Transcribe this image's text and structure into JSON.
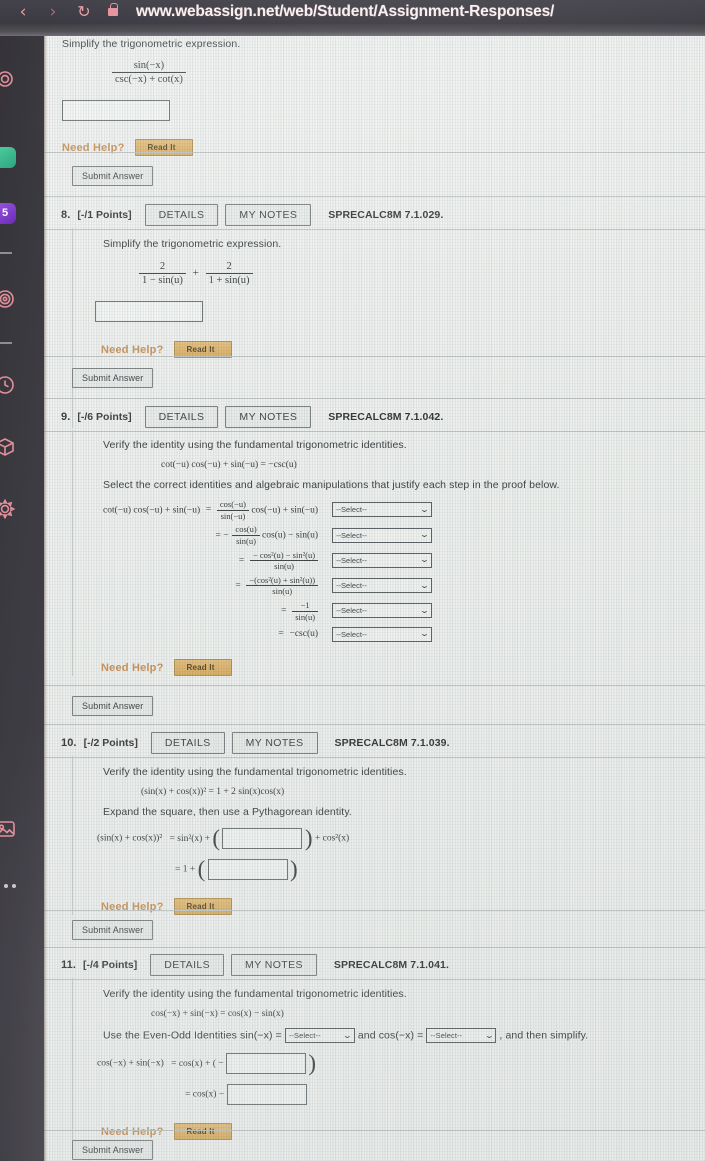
{
  "browser": {
    "url": "www.webassign.net/web/Student/Assignment-Responses/",
    "back_icon": "‹",
    "forward_icon": "›",
    "reload_icon": "↻",
    "lock_icon": "lock-icon"
  },
  "rail": {
    "icons": [
      {
        "name": "app-green-icon",
        "glyph": "",
        "color": "#3ec88a"
      },
      {
        "name": "app-purple-icon",
        "glyph": "5",
        "color": "#8b3ff0"
      },
      {
        "name": "spiral-icon",
        "glyph": "◎",
        "color": "#f08a9a"
      },
      {
        "name": "clock-icon",
        "glyph": "◴",
        "color": "#f08a9a"
      },
      {
        "name": "cube-icon",
        "glyph": "⬡",
        "color": "#f08a9a"
      },
      {
        "name": "gear-icon",
        "glyph": "⚙",
        "color": "#f08a9a"
      },
      {
        "name": "image-icon",
        "glyph": "Ὓc",
        "color": "#f08a9a"
      }
    ],
    "overflow_label": "• • •"
  },
  "common": {
    "details_label": "DETAILS",
    "mynotes_label": "MY NOTES",
    "need_help_label": "Need Help?",
    "read_it_label": "Read It",
    "submit_label": "Submit Answer",
    "select_placeholder": "--Select--",
    "caret": "⌄"
  },
  "questions": [
    {
      "number": "",
      "points": "",
      "code": "",
      "prompt": "Simplify the trigonometric expression.",
      "expression": {
        "numerator": "sin(−x)",
        "denominator": "csc(−x) + cot(x)"
      }
    },
    {
      "number": "8.",
      "points": "[-/1 Points]",
      "code": "SPRECALC8M 7.1.029.",
      "prompt": "Simplify the trigonometric expression.",
      "expression": {
        "term1_num": "2",
        "term1_den": "1 − sin(u)",
        "operator": "+",
        "term2_num": "2",
        "term2_den": "1 + sin(u)"
      }
    },
    {
      "number": "9.",
      "points": "[-/6 Points]",
      "code": "SPRECALC8M 7.1.042.",
      "prompt": "Verify the identity using the fundamental trigonometric identities.",
      "identity": "cot(−u) cos(−u) + sin(−u) = −csc(u)",
      "instruction": "Select the correct identities and algebraic manipulations that justify each step in the proof below.",
      "proof_steps": [
        {
          "left": "cot(−u) cos(−u) + sin(−u)",
          "eq": "=",
          "right_num": "cos(−u)",
          "right_den": "sin(−u)",
          "tail": "cos(−u) + sin(−u)"
        },
        {
          "left": "",
          "eq": "= −",
          "right_num": "cos(u)",
          "right_den": "sin(u)",
          "tail": "cos(u) − sin(u)"
        },
        {
          "left": "",
          "eq": "=",
          "right_num": "− cos²(u) − sin²(u)",
          "right_den": "sin(u)",
          "tail": ""
        },
        {
          "left": "",
          "eq": "=",
          "right_num": "−(cos²(u) + sin²(u))",
          "right_den": "sin(u)",
          "tail": ""
        },
        {
          "left": "",
          "eq": "=",
          "right_num": "−1",
          "right_den": "sin(u)",
          "tail": ""
        },
        {
          "left": "",
          "eq": "=",
          "right_num": "",
          "right_den": "",
          "tail": "−csc(u)"
        }
      ]
    },
    {
      "number": "10.",
      "points": "[-/2 Points]",
      "code": "SPRECALC8M 7.1.039.",
      "prompt": "Verify the identity using the fundamental trigonometric identities.",
      "identity": "(sin(x) + cos(x))² = 1 + 2 sin(x)cos(x)",
      "instruction": "Expand the square, then use a Pythagorean identity.",
      "line1_left": "(sin(x) + cos(x))²",
      "line1_mid": "= sin²(x) +",
      "line1_tail": "+ cos²(x)",
      "line2_mid": "= 1 +"
    },
    {
      "number": "11.",
      "points": "[-/4 Points]",
      "code": "SPRECALC8M 7.1.041.",
      "prompt": "Verify the identity using the fundamental trigonometric identities.",
      "identity": "cos(−x) + sin(−x) = cos(x) − sin(x)",
      "instruction_a": "Use the Even-Odd Identities sin(−x) =",
      "instruction_b": "and cos(−x) =",
      "instruction_c": ", and then simplify.",
      "line1_left": "cos(−x) + sin(−x)",
      "line1_mid": "= cos(x) + ( −",
      "line1_close": ")",
      "line2_mid": "= cos(x) −"
    }
  ]
}
